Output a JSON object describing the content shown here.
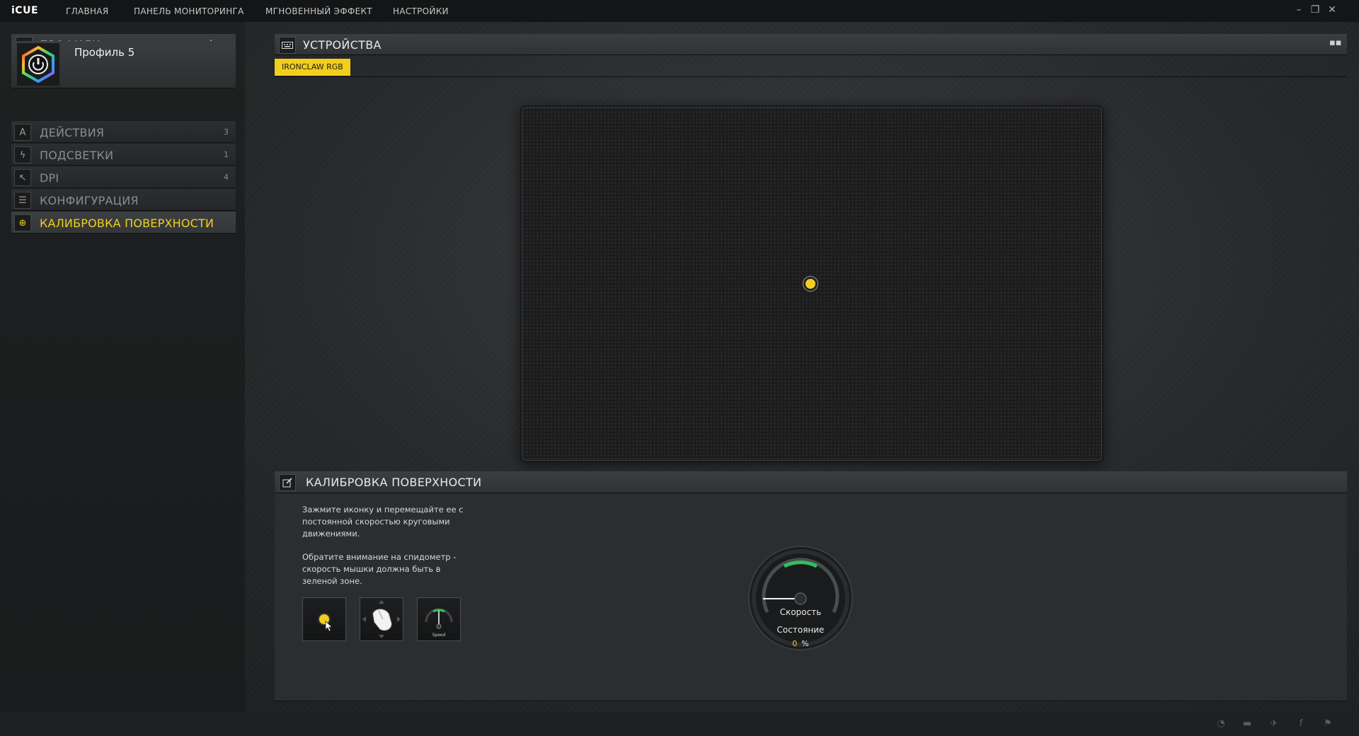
{
  "app": {
    "brand": "iCUE"
  },
  "nav": [
    {
      "label": "ГЛАВНАЯ"
    },
    {
      "label": "ПАНЕЛЬ МОНИТОРИНГА"
    },
    {
      "label": "МГНОВЕННЫЙ ЭФФЕКТ"
    },
    {
      "label": "НАСТРОЙКИ"
    }
  ],
  "window_controls": {
    "minimize": "–",
    "restore": "❐",
    "close": "✕"
  },
  "profiles": {
    "title": "ПРОФИЛИ",
    "add_symbol": "+",
    "menu_symbol": "≡",
    "current": {
      "name": "Профиль 5"
    }
  },
  "menu": [
    {
      "label": "ДЕЙСТВИЯ",
      "count": "3",
      "icon": "A"
    },
    {
      "label": "ПОДСВЕТКИ",
      "count": "1",
      "icon": "ϟ"
    },
    {
      "label": "DPI",
      "count": "4",
      "icon": "↖"
    },
    {
      "label": "КОНФИГУРАЦИЯ",
      "count": "",
      "icon": "☰"
    },
    {
      "label": "КАЛИБРОВКА ПОВЕРХНОСТИ",
      "count": "",
      "icon": "⊕"
    }
  ],
  "devices": {
    "title": "УСТРОЙСТВА",
    "tab": "IRONCLAW RGB"
  },
  "calibration": {
    "title": "КАЛИБРОВКА ПОВЕРХНОСТИ",
    "instruction_1": "Зажмите иконку и перемещайте ее с постоянной скоростью круговыми движениями.",
    "instruction_2": "Обратите внимание на спидометр - скорость мышки должна быть в зеленой зоне.",
    "step3_caption": "Speed",
    "gauge_speed_label": "Скорость",
    "gauge_state_label": "Состояние",
    "progress_value": "0",
    "progress_unit": "%"
  },
  "colors": {
    "accent": "#f2cf1d",
    "gauge_green": "#2fc25b"
  }
}
